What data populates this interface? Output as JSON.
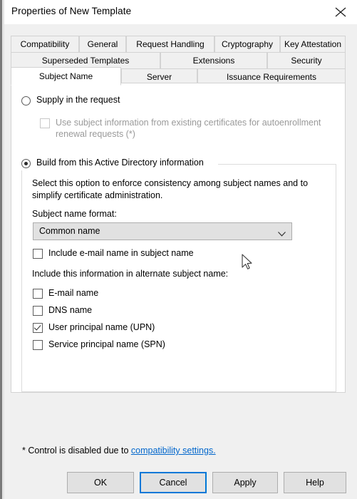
{
  "window": {
    "title": "Properties of New Template",
    "close_icon": "close-icon"
  },
  "tabs": {
    "row1": [
      {
        "label": "Compatibility",
        "active": false
      },
      {
        "label": "General",
        "active": false
      },
      {
        "label": "Request Handling",
        "active": false
      },
      {
        "label": "Cryptography",
        "active": false
      },
      {
        "label": "Key Attestation",
        "active": false
      }
    ],
    "row2": [
      {
        "label": "Superseded Templates",
        "active": false
      },
      {
        "label": "Extensions",
        "active": false
      },
      {
        "label": "Security",
        "active": false
      }
    ],
    "row3": [
      {
        "label": "Subject Name",
        "active": true
      },
      {
        "label": "Server",
        "active": false
      },
      {
        "label": "Issuance Requirements",
        "active": false
      }
    ]
  },
  "panel": {
    "supply_option": {
      "label": "Supply in the request",
      "checked": false
    },
    "reuse_checkbox": {
      "label": "Use subject information from existing certificates for autoenrollment renewal requests (*)",
      "checked": false,
      "disabled": true
    },
    "build_option": {
      "label": "Build from this Active Directory information",
      "checked": true
    },
    "description": "Select this option to enforce consistency among subject names and to simplify certificate administration.",
    "subject_name_format": {
      "label": "Subject name format:",
      "value": "Common name",
      "arrow_icon": "chevron-down-icon",
      "options": [
        "Common name"
      ]
    },
    "include_email_checkbox": {
      "label": "Include e-mail name in subject name",
      "checked": false
    },
    "alternate_label": "Include this information in alternate subject name:",
    "alternate_items": [
      {
        "label": "E-mail name",
        "checked": false
      },
      {
        "label": "DNS name",
        "checked": false
      },
      {
        "label": "User principal name (UPN)",
        "checked": true
      },
      {
        "label": "Service principal name (SPN)",
        "checked": false
      }
    ],
    "footnote_prefix": "* Control is disabled due to ",
    "footnote_link": "compatibility settings."
  },
  "buttons": {
    "ok": "OK",
    "cancel": "Cancel",
    "apply": "Apply",
    "help": "Help"
  },
  "colors": {
    "accent": "#0078d7",
    "link": "#0066cc",
    "dialog_bg": "#f0f0f0",
    "panel_bg": "#ffffff",
    "control_bg": "#e1e1e1",
    "disabled_text": "#9a9a9a"
  }
}
